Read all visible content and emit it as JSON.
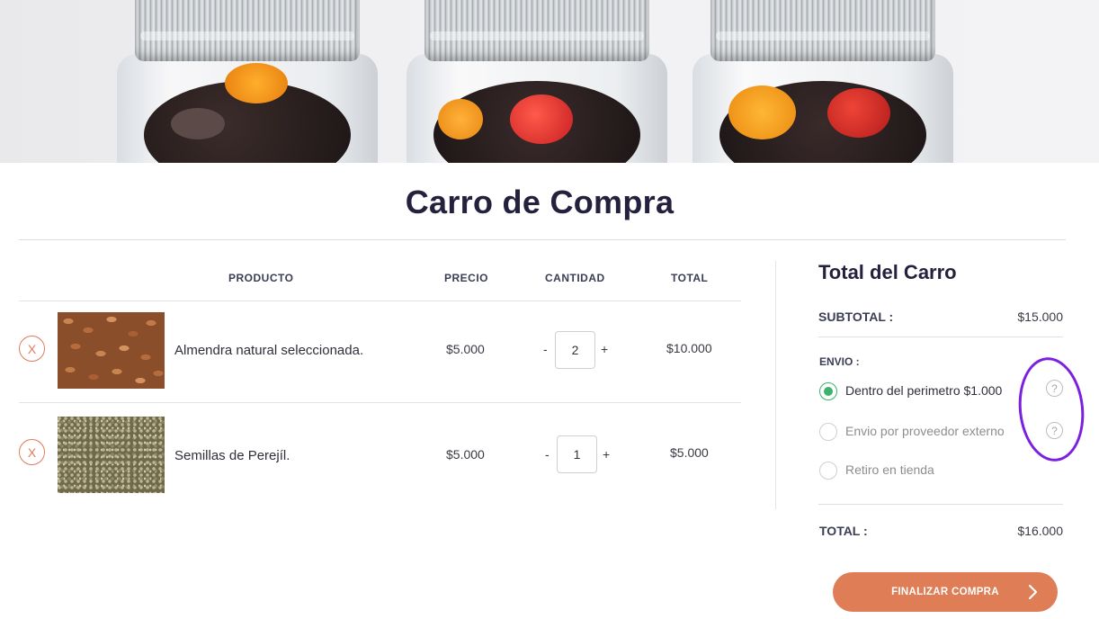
{
  "page": {
    "title": "Carro de Compra"
  },
  "cart": {
    "headers": {
      "product": "PRODUCTO",
      "price": "PRECIO",
      "quantity": "CANTIDAD",
      "total": "TOTAL"
    },
    "items": [
      {
        "remove_label": "X",
        "name": "Almendra natural seleccionada.",
        "price": "$5.000",
        "qty_minus": "-",
        "quantity": "2",
        "qty_plus": "+",
        "total": "$10.000",
        "image_icon": "almonds-photo"
      },
      {
        "remove_label": "X",
        "name": "Semillas de Perejíl.",
        "price": "$5.000",
        "qty_minus": "-",
        "quantity": "1",
        "qty_plus": "+",
        "total": "$5.000",
        "image_icon": "parsley-seeds-photo"
      }
    ]
  },
  "totals": {
    "title": "Total del Carro",
    "subtotal_label": "SUBTOTAL :",
    "subtotal_value": "$15.000",
    "shipping_label": "ENVIO :",
    "shipping_options": [
      {
        "label": "Dentro del perimetro $1.000",
        "selected": true,
        "help": "?"
      },
      {
        "label": "Envio por proveedor externo",
        "selected": false,
        "help": "?"
      },
      {
        "label": "Retiro en tienda",
        "selected": false
      }
    ],
    "total_label": "TOTAL :",
    "total_value": "$16.000"
  },
  "checkout": {
    "label": "FINALIZAR COMPRA"
  },
  "colors": {
    "accent": "#de7d56",
    "selected_radio": "#3bb36e",
    "heading": "#23213d",
    "annotation": "#7b1fe0"
  }
}
